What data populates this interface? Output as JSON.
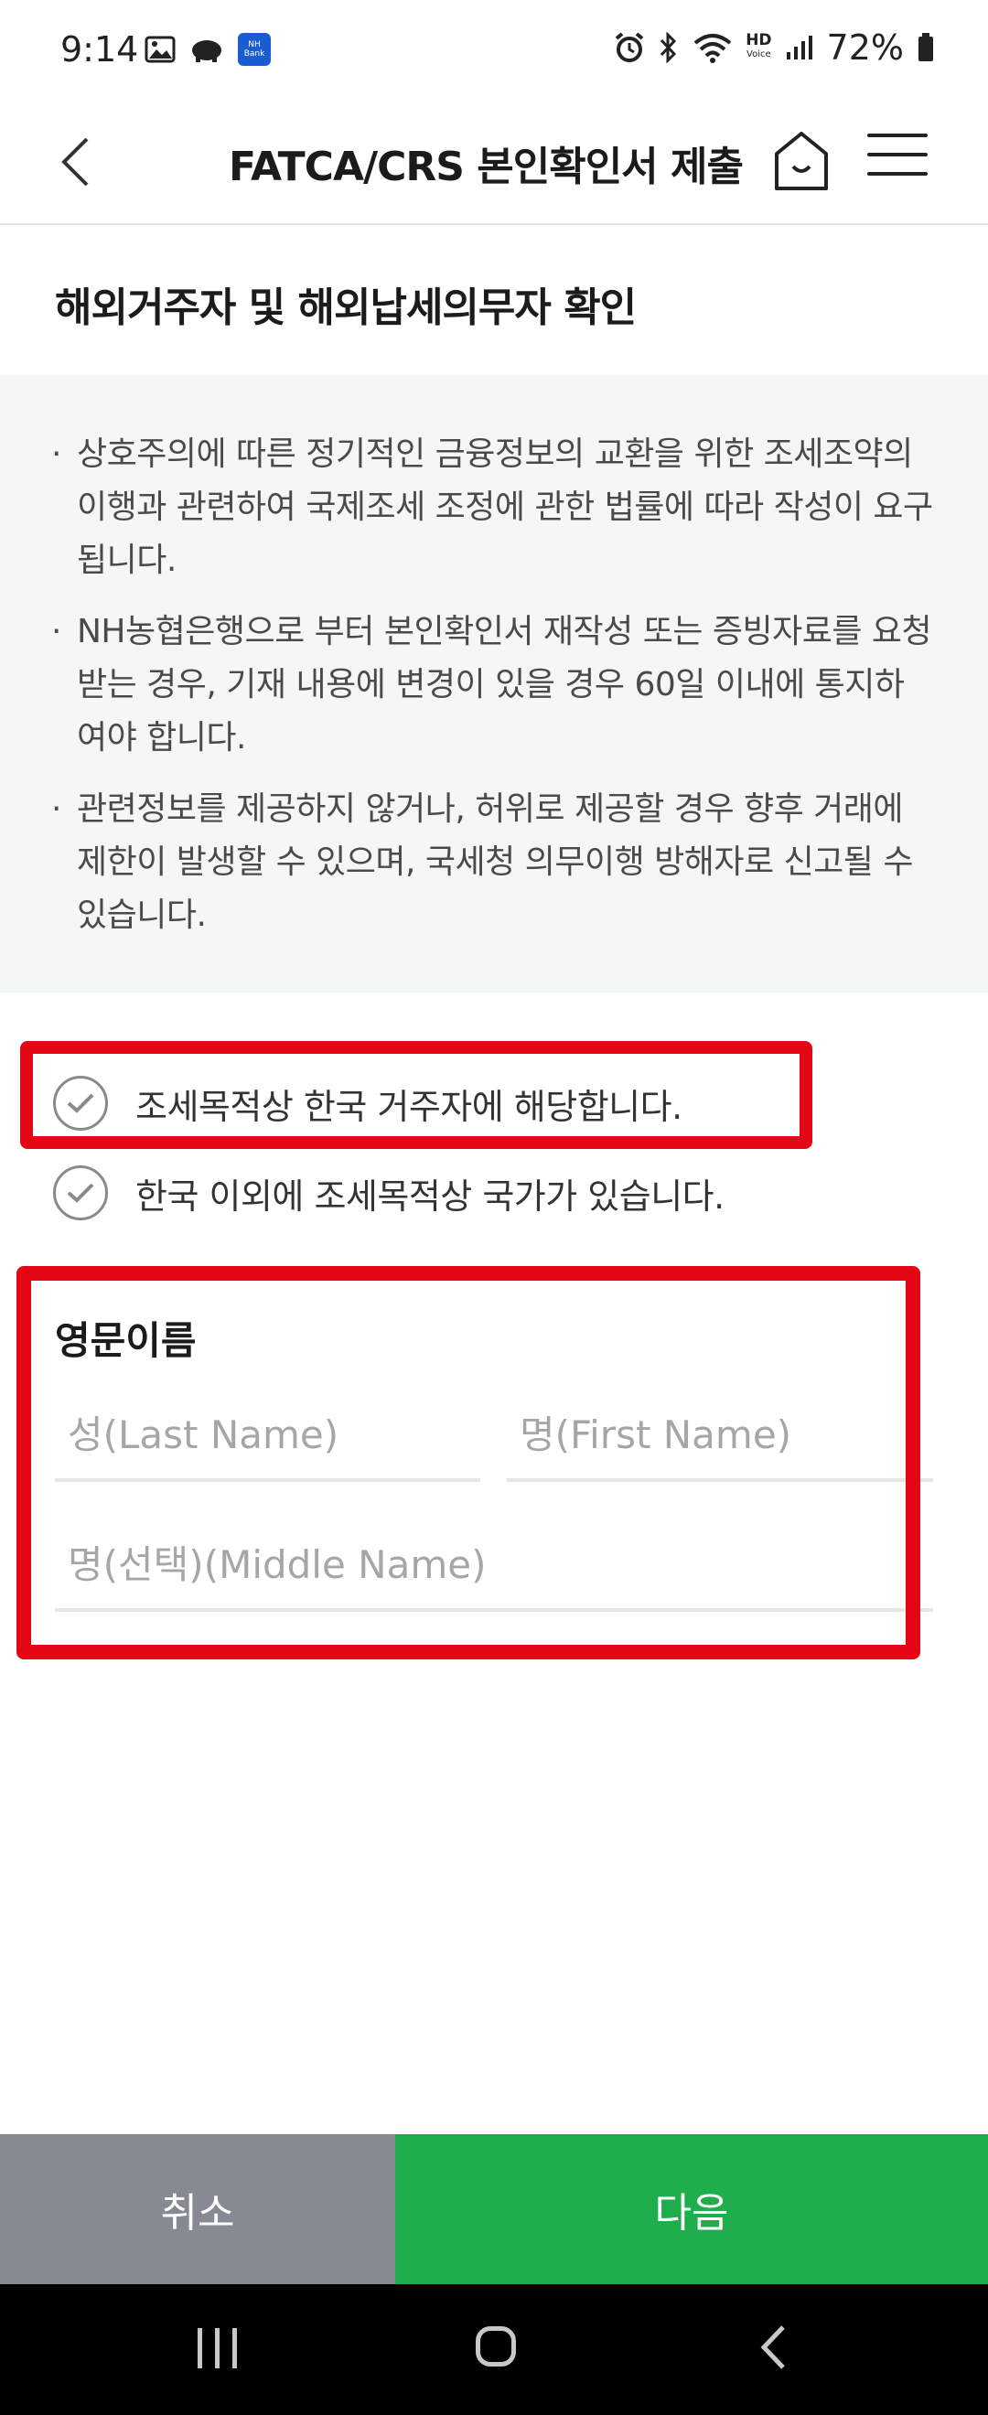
{
  "status_bar": {
    "time": "9:14",
    "nh_badge_line1": "NH",
    "nh_badge_line2": "Bank",
    "hd_label": "HD",
    "voice_label": "Voice",
    "battery": "72%"
  },
  "header": {
    "title": "FATCA/CRS 본인확인서 제출"
  },
  "section": {
    "title": "해외거주자 및 해외납세의무자 확인"
  },
  "notice": {
    "bullet": "·",
    "items": [
      "상호주의에 따른 정기적인 금융정보의 교환을 위한 조세조약의 이행과 관련하여 국제조세 조정에 관한 법률에 따라 작성이 요구됩니다.",
      "NH농협은행으로 부터 본인확인서 재작성 또는 증빙자료를 요청받는 경우, 기재 내용에 변경이 있을 경우 60일 이내에 통지하여야 합니다.",
      "관련정보를 제공하지 않거나, 허위로 제공할 경우 향후 거래에 제한이 발생할 수 있으며, 국세청 의무이행 방해자로 신고될 수 있습니다."
    ]
  },
  "options": [
    {
      "label": "조세목적상 한국 거주자에 해당합니다.",
      "checked": false
    },
    {
      "label": "한국 이외에 조세목적상 국가가 있습니다.",
      "checked": false
    }
  ],
  "name_form": {
    "label": "영문이름",
    "last_name": {
      "placeholder": "성(Last Name)",
      "value": ""
    },
    "first_name": {
      "placeholder": "명(First Name)",
      "value": ""
    },
    "middle_name": {
      "placeholder": "명(선택)(Middle Name)",
      "value": ""
    }
  },
  "buttons": {
    "cancel": "취소",
    "next": "다음"
  },
  "colors": {
    "highlight": "#e30613",
    "next_button": "#1fae4b",
    "cancel_button": "#858a93",
    "notice_background": "#f3f8f4"
  }
}
